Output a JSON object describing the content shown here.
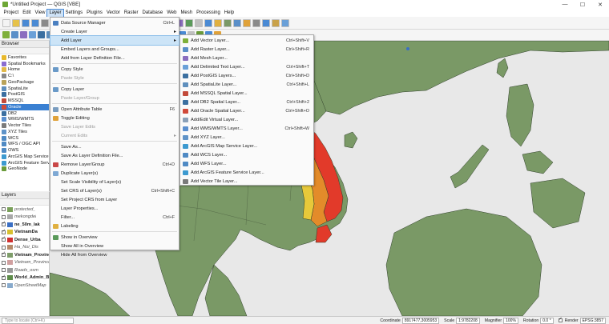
{
  "window": {
    "title": "*Untitled Project — QGIS [VBE]",
    "min_glyph": "—",
    "max_glyph": "☐",
    "close_glyph": "✕"
  },
  "menubar": [
    "Project",
    "Edit",
    "View",
    "Layer",
    "Settings",
    "Plugins",
    "Vector",
    "Raster",
    "Database",
    "Web",
    "Mesh",
    "Processing",
    "Help"
  ],
  "active_menu": "Layer",
  "browser": {
    "title": "Browser",
    "items": [
      {
        "label": "Favorites",
        "icon": "star-icon",
        "color": "#e8b82a"
      },
      {
        "label": "Spatial Bookmarks",
        "icon": "bookmark-icon",
        "color": "#8a6dd0"
      },
      {
        "label": "Home",
        "icon": "folder-icon",
        "color": "#e2b94a"
      },
      {
        "label": "C:\\",
        "icon": "drive-icon",
        "color": "#888888"
      },
      {
        "label": "GeoPackage",
        "icon": "geopackage-icon",
        "color": "#b9a35a"
      },
      {
        "label": "SpatiaLite",
        "icon": "spatialite-icon",
        "color": "#5f8fbd"
      },
      {
        "label": "PostGIS",
        "icon": "postgis-icon",
        "color": "#3b6fa0"
      },
      {
        "label": "MSSQL",
        "icon": "mssql-icon",
        "color": "#c24a3a"
      },
      {
        "label": "Oracle",
        "icon": "oracle-icon",
        "color": "#d04a3a"
      },
      {
        "label": "DB2",
        "icon": "db2-icon",
        "color": "#3b6fa0"
      },
      {
        "label": "WMS/WMTS",
        "icon": "wms-icon",
        "color": "#5a8fcf"
      },
      {
        "label": "Vector Tiles",
        "icon": "vector-tiles-icon",
        "color": "#7a7a7a"
      },
      {
        "label": "XYZ Tiles",
        "icon": "xyz-tiles-icon",
        "color": "#5f93c8"
      },
      {
        "label": "WCS",
        "icon": "wcs-icon",
        "color": "#4f8ac4"
      },
      {
        "label": "WFS / OGC API",
        "icon": "wfs-icon",
        "color": "#4f8ac4"
      },
      {
        "label": "OWS",
        "icon": "ows-icon",
        "color": "#4f8ac4"
      },
      {
        "label": "ArcGIS Map Service",
        "icon": "arcgis-map-icon",
        "color": "#3d9ad0"
      },
      {
        "label": "ArcGIS Feature Service",
        "icon": "arcgis-feature-icon",
        "color": "#3d9ad0"
      },
      {
        "label": "GeoNode",
        "icon": "geonode-icon",
        "color": "#6a9b3a"
      }
    ],
    "selected": "Oracle"
  },
  "layers": {
    "title": "Layers",
    "items": [
      {
        "label": "protected_",
        "checked": false,
        "style": "it",
        "color": "#7aa05a"
      },
      {
        "label": "mekongdel",
        "checked": false,
        "style": "it",
        "color": "#a8a8a8"
      },
      {
        "label": "ne_50m_lak",
        "checked": true,
        "style": "b",
        "color": "#3a6fc4"
      },
      {
        "label": "VietnamDa",
        "checked": true,
        "style": "b",
        "color": "#d8c030"
      },
      {
        "label": "Dense_Urba",
        "checked": true,
        "style": "b",
        "color": "#d03030"
      },
      {
        "label": "Ha_Noi_Dis",
        "checked": false,
        "style": "it",
        "color": "#b58a6a"
      },
      {
        "label": "Vietnam_Provinces",
        "checked": true,
        "style": "b",
        "color": "#7e9d6a"
      },
      {
        "label": "Vietnam_Provinces",
        "checked": false,
        "style": "it",
        "color": "#d0a0a0"
      },
      {
        "label": "Roads_osm",
        "checked": false,
        "style": "it",
        "color": "#999999"
      },
      {
        "label": "World_Admin_Boundaries",
        "checked": true,
        "style": "b",
        "color": "#5e8c4a"
      },
      {
        "label": "OpenStreetMap",
        "checked": false,
        "style": "it",
        "color": "#88aacc"
      }
    ]
  },
  "layer_menu": {
    "items": [
      {
        "label": "Data Source Manager",
        "shortcut": "Ctrl+L",
        "icon": "data-source-manager-icon",
        "icolor": "#4a7fc0"
      },
      {
        "label": "Create Layer",
        "shortcut": "",
        "submenu": true
      },
      {
        "label": "Add Layer",
        "shortcut": "",
        "submenu": true,
        "highlight": true
      },
      {
        "label": "Embed Layers and Groups...",
        "shortcut": ""
      },
      {
        "label": "Add from Layer Definition File...",
        "shortcut": ""
      },
      {
        "sep": true
      },
      {
        "label": "Copy Style",
        "shortcut": "",
        "icon": "copy-style-icon",
        "icolor": "#6a9ac8"
      },
      {
        "label": "Paste Style",
        "shortcut": "",
        "disabled": true
      },
      {
        "sep": true
      },
      {
        "label": "Copy Layer",
        "shortcut": "",
        "icon": "copy-layer-icon",
        "icolor": "#6a9ac8"
      },
      {
        "label": "Paste Layer/Group",
        "shortcut": "",
        "disabled": true
      },
      {
        "sep": true
      },
      {
        "label": "Open Attribute Table",
        "shortcut": "F6",
        "icon": "attribute-table-icon",
        "icolor": "#7a9dc0"
      },
      {
        "label": "Toggle Editing",
        "shortcut": "",
        "icon": "pencil-icon",
        "icolor": "#e0a23a"
      },
      {
        "label": "Save Layer Edits",
        "shortcut": "",
        "disabled": true
      },
      {
        "label": "Current Edits",
        "shortcut": "",
        "disabled": true,
        "submenu": true
      },
      {
        "sep": true
      },
      {
        "label": "Save As...",
        "shortcut": ""
      },
      {
        "label": "Save As Layer Definition File...",
        "shortcut": ""
      },
      {
        "label": "Remove Layer/Group",
        "shortcut": "Ctrl+D",
        "icon": "remove-layer-icon",
        "icolor": "#c94848"
      },
      {
        "label": "Duplicate Layer(s)",
        "shortcut": "",
        "icon": "duplicate-layer-icon",
        "icolor": "#7fa9d4"
      },
      {
        "label": "Set Scale Visibility of Layer(s)",
        "shortcut": ""
      },
      {
        "label": "Set CRS of Layer(s)",
        "shortcut": "Ctrl+Shift+C"
      },
      {
        "label": "Set Project CRS from Layer",
        "shortcut": ""
      },
      {
        "label": "Layer Properties...",
        "shortcut": ""
      },
      {
        "label": "Filter...",
        "shortcut": "Ctrl+F"
      },
      {
        "label": "Labeling",
        "shortcut": "",
        "icon": "labeling-icon",
        "icolor": "#e0b040"
      },
      {
        "sep": true
      },
      {
        "label": "Show in Overview",
        "shortcut": "",
        "icon": "overview-icon",
        "icolor": "#5a9a5a"
      },
      {
        "label": "Show All in Overview",
        "shortcut": ""
      },
      {
        "label": "Hide All from Overview",
        "shortcut": ""
      }
    ]
  },
  "add_layer_menu": {
    "items": [
      {
        "label": "Add Vector Layer...",
        "shortcut": "Ctrl+Shift+V",
        "icon": "add-vector-layer-icon",
        "icolor": "#7fb03a"
      },
      {
        "label": "Add Raster Layer...",
        "shortcut": "Ctrl+Shift+R",
        "icon": "add-raster-layer-icon",
        "icolor": "#5a8fc8"
      },
      {
        "label": "Add Mesh Layer...",
        "shortcut": "",
        "icon": "add-mesh-layer-icon",
        "icolor": "#8a6dbf"
      },
      {
        "label": "Add Delimited Text Layer...",
        "shortcut": "Ctrl+Shift+T",
        "icon": "add-delimited-text-icon",
        "icolor": "#6aa0d8"
      },
      {
        "label": "Add PostGIS Layers...",
        "shortcut": "Ctrl+Shift+D",
        "icon": "add-postgis-icon",
        "icolor": "#3b6fa0"
      },
      {
        "label": "Add SpatiaLite Layer...",
        "shortcut": "Ctrl+Shift+L",
        "icon": "add-spatialite-icon",
        "icolor": "#5f8fbd"
      },
      {
        "label": "Add MSSQL Spatial Layer...",
        "shortcut": "",
        "icon": "add-mssql-icon",
        "icolor": "#c24a3a"
      },
      {
        "label": "Add DB2 Spatial Layer...",
        "shortcut": "Ctrl+Shift+2",
        "icon": "add-db2-icon",
        "icolor": "#3b6fa0"
      },
      {
        "label": "Add Oracle Spatial Layer...",
        "shortcut": "Ctrl+Shift+O",
        "icon": "add-oracle-icon",
        "icolor": "#d04a3a"
      },
      {
        "label": "Add/Edit Virtual Layer...",
        "shortcut": "",
        "icon": "add-virtual-layer-icon",
        "icolor": "#8aa0b8"
      },
      {
        "label": "Add WMS/WMTS Layer...",
        "shortcut": "Ctrl+Shift+W",
        "icon": "add-wms-icon",
        "icolor": "#5a8fcf"
      },
      {
        "label": "Add XYZ Layer...",
        "shortcut": "",
        "icon": "add-xyz-icon",
        "icolor": "#5f93c8"
      },
      {
        "label": "Add ArcGIS Map Service Layer...",
        "shortcut": "",
        "icon": "add-arcgis-map-icon",
        "icolor": "#3d9ad0"
      },
      {
        "label": "Add WCS Layer...",
        "shortcut": "",
        "icon": "add-wcs-icon",
        "icolor": "#4f8ac4"
      },
      {
        "label": "Add WFS Layer...",
        "shortcut": "",
        "icon": "add-wfs-icon",
        "icolor": "#4f8ac4"
      },
      {
        "label": "Add ArcGIS Feature Service Layer...",
        "shortcut": "",
        "icon": "add-arcgis-feature-icon",
        "icolor": "#3d9ad0"
      },
      {
        "label": "Add Vector Tile Layer...",
        "shortcut": "",
        "icon": "add-vector-tile-icon",
        "icolor": "#7a7a7a"
      }
    ]
  },
  "statusbar": {
    "locator_placeholder": "Type to locate (Ctrl+K)",
    "coordinate_label": "Coordinate",
    "coordinate_value": "8917477,3005953",
    "scale_label": "Scale",
    "scale_value": "1:9782208",
    "magnifier_label": "Magnifier",
    "magnifier_value": "100%",
    "rotation_label": "Rotation",
    "rotation_value": "0.0 °",
    "render_label": "Render",
    "crs": "EPSG:3857"
  },
  "colors": {
    "land": "#7a9966",
    "sea": "#e8e8e8",
    "hot": "#e23a2a",
    "warm": "#e38b2a",
    "mild": "#e7c93a",
    "accent": "#3a80d2"
  }
}
